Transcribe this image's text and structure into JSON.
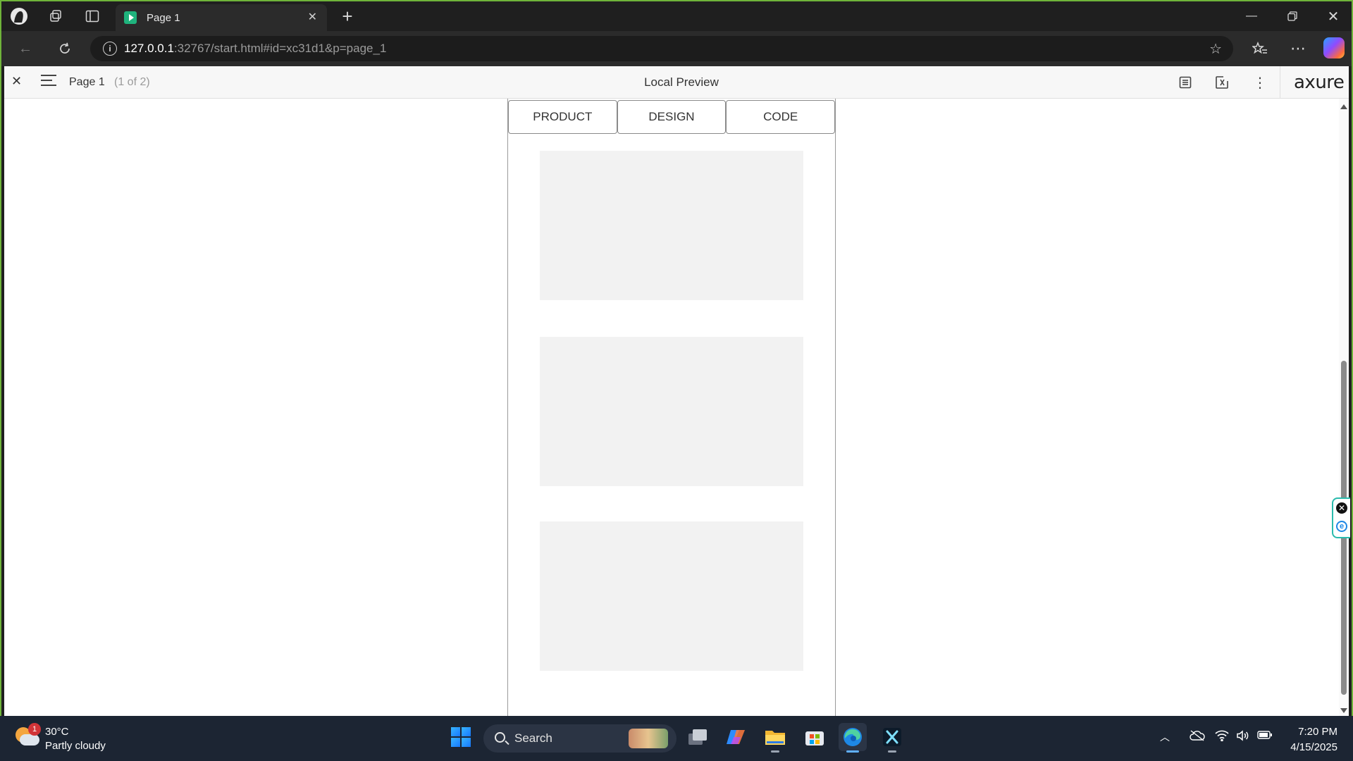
{
  "browser": {
    "tab_title": "Page 1",
    "url_host": "127.0.0.1",
    "url_rest": ":32767/start.html#id=xc31d1&p=page_1"
  },
  "axure": {
    "page_name": "Page 1",
    "page_count": "(1 of 2)",
    "preview_title": "Local Preview",
    "logo": "axure"
  },
  "prototype": {
    "tabs": [
      {
        "label": "PRODUCT"
      },
      {
        "label": "DESIGN"
      },
      {
        "label": "CODE"
      }
    ],
    "cards": 3
  },
  "taskbar": {
    "weather_temp": "30°C",
    "weather_desc": "Partly cloudy",
    "weather_badge": "1",
    "search_label": "Search",
    "time": "7:20 PM",
    "date": "4/15/2025"
  },
  "colors": {
    "frame_accent": "#6fb43a",
    "tab_favicon": "#1fb37d",
    "card_fill": "#f2f2f2"
  }
}
